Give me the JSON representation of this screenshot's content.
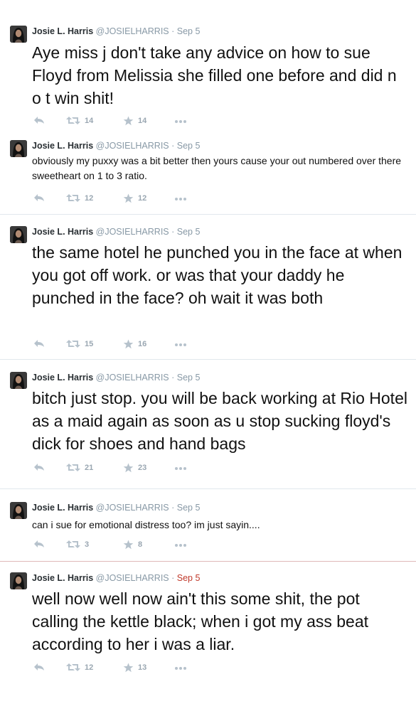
{
  "tweets": [
    {
      "name": "Josie L. Harris",
      "handle": "@JOSIELHARRIS",
      "date": "Sep 5",
      "text": "Aye miss j don't take any advice on how to sue Floyd from Melissia she filled one before and did n o t win shit!",
      "retweets": "14",
      "favorites": "14",
      "text_size": "big",
      "date_color": "gray"
    },
    {
      "name": "Josie L. Harris",
      "handle": "@JOSIELHARRIS",
      "date": "Sep 5",
      "text": "obviously my puxxy was a bit better then yours cause your out numbered over there sweetheart on 1 to 3 ratio.",
      "retweets": "12",
      "favorites": "12",
      "text_size": "small",
      "date_color": "gray"
    },
    {
      "name": "Josie L. Harris",
      "handle": "@JOSIELHARRIS",
      "date": "Sep 5",
      "text": "the same hotel he punched you in the face at when you got off work.  or was that your daddy he punched in the face? oh wait it was both",
      "retweets": "15",
      "favorites": "16",
      "text_size": "big",
      "date_color": "gray"
    },
    {
      "name": "Josie L. Harris",
      "handle": "@JOSIELHARRIS",
      "date": "Sep 5",
      "text": "bitch just stop. you will be back working at Rio Hotel as a maid again as soon as u stop sucking floyd's dick for shoes and hand bags",
      "retweets": "21",
      "favorites": "23",
      "text_size": "big",
      "date_color": "gray"
    },
    {
      "name": "Josie L. Harris",
      "handle": "@JOSIELHARRIS",
      "date": "Sep 5",
      "text": "can i sue for emotional distress too?  im just sayin....",
      "retweets": "3",
      "favorites": "8",
      "text_size": "small",
      "date_color": "gray"
    },
    {
      "name": "Josie L. Harris",
      "handle": "@JOSIELHARRIS",
      "date": "Sep 5",
      "text": "well now well now ain't this some shit, the pot calling the kettle black; when i got my ass beat according to her i was a liar.",
      "retweets": "12",
      "favorites": "13",
      "text_size": "big",
      "date_color": "red"
    }
  ],
  "icons": {
    "reply": "reply-icon",
    "retweet": "retweet-icon",
    "favorite": "star-icon",
    "more": "more-dots-icon",
    "avatar": "profile-avatar"
  },
  "colors": {
    "name": "#292f33",
    "meta": "#8899a6",
    "action": "#b6c2cc",
    "date_highlight": "#c0392b"
  }
}
